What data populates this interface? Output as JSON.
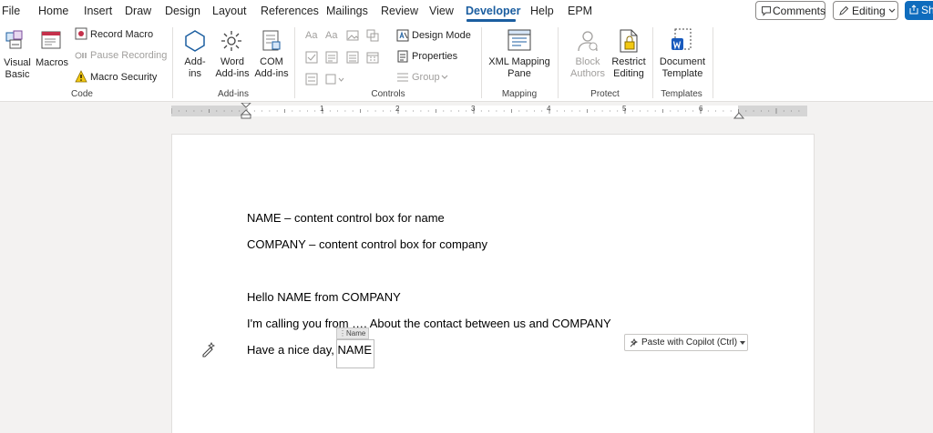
{
  "menu": {
    "tabs": [
      {
        "label": "File"
      },
      {
        "label": "Home"
      },
      {
        "label": "Insert"
      },
      {
        "label": "Draw"
      },
      {
        "label": "Design"
      },
      {
        "label": "Layout"
      },
      {
        "label": "References"
      },
      {
        "label": "Mailings"
      },
      {
        "label": "Review"
      },
      {
        "label": "View"
      },
      {
        "label": "Developer",
        "active": true
      },
      {
        "label": "Help"
      },
      {
        "label": "EPM"
      }
    ],
    "comments_label": "Comments",
    "editing_label": "Editing",
    "share_label": "Sh"
  },
  "ribbon": {
    "code": {
      "group_label": "Code",
      "visual_basic": "Visual Basic",
      "macros": "Macros",
      "record_macro": "Record Macro",
      "pause_recording": "Pause Recording",
      "macro_security": "Macro Security"
    },
    "addins": {
      "group_label": "Add-ins",
      "addins": "Add-ins",
      "word_addins": "Word Add-ins",
      "com_addins": "COM Add-ins"
    },
    "controls": {
      "group_label": "Controls",
      "design_mode": "Design Mode",
      "properties": "Properties",
      "group": "Group"
    },
    "mapping": {
      "group_label": "Mapping",
      "xml_mapping_pane": "XML Mapping Pane"
    },
    "protect": {
      "group_label": "Protect",
      "block_authors": "Block Authors",
      "restrict_editing": "Restrict Editing"
    },
    "templates": {
      "group_label": "Templates",
      "document_template": "Document Template"
    }
  },
  "ruler": {
    "numbers": [
      "1",
      "2",
      "3",
      "4",
      "5",
      "6"
    ]
  },
  "document": {
    "lines": [
      "NAME – content control box for name",
      "COMPANY – content control box for company",
      "Hello NAME from COMPANY",
      "I'm calling you from …. About the contact between us and COMPANY",
      "Have a nice day, NAME"
    ],
    "content_control_tag": "Name",
    "paste_copilot": "Paste with Copilot (Ctrl)"
  },
  "colors": {
    "accent": "#1b5ea0",
    "share": "#0f6cbd",
    "canvas": "#f3f2f1"
  }
}
